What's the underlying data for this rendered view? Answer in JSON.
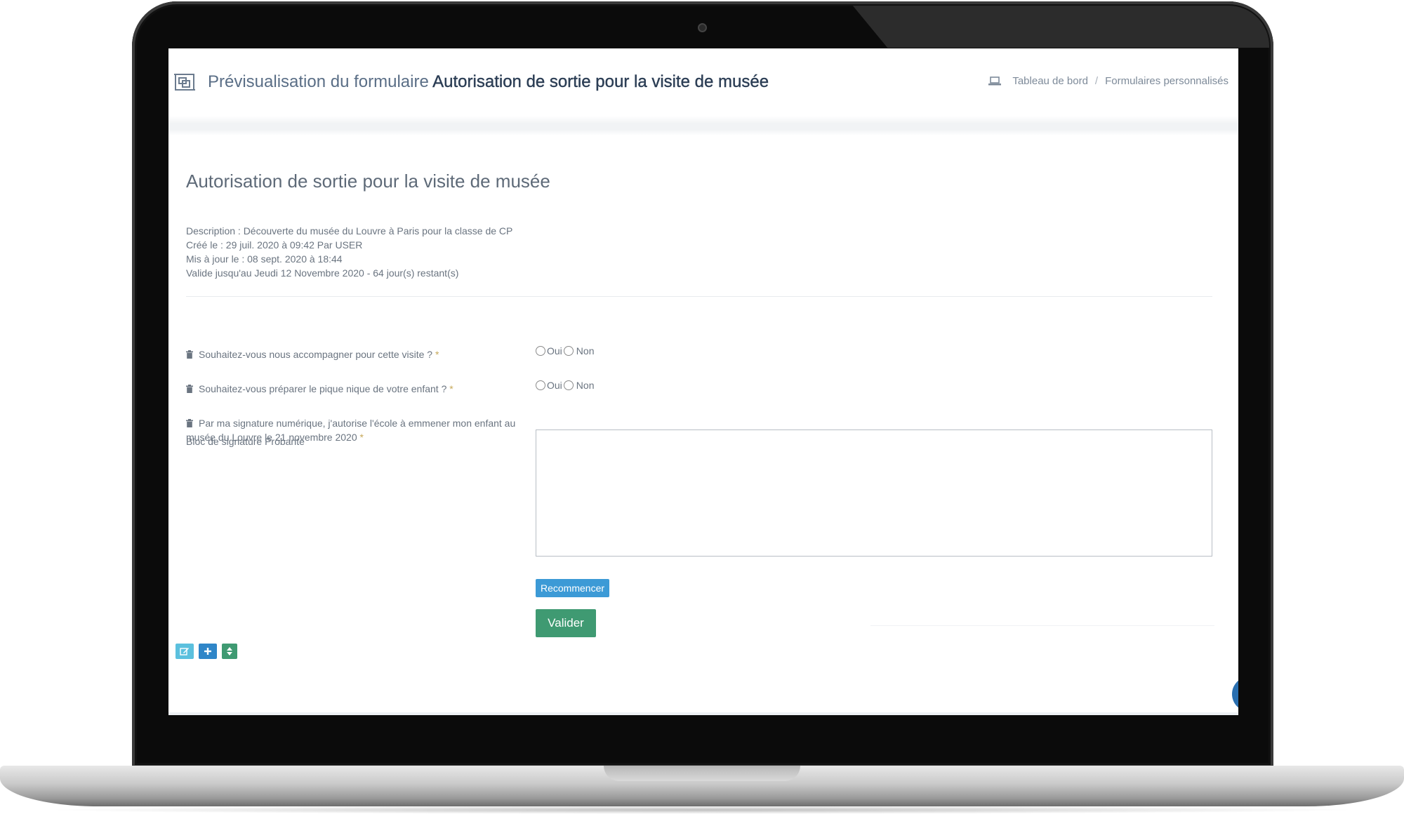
{
  "header": {
    "title_prefix": "Prévisualisation du formulaire",
    "title_form_name": "Autorisation de sortie pour la visite de musée",
    "breadcrumb": [
      "Tableau de bord",
      "Formulaires personnalisés"
    ],
    "breadcrumb_separator": "/"
  },
  "form": {
    "title": "Autorisation de sortie pour la visite de musée",
    "meta": [
      "Description : Découverte du musée du Louvre à Paris pour la classe de CP",
      "Créé le : 29 juil. 2020 à 09:42 Par USER",
      "Mis à jour le : 08 sept. 2020 à 18:44",
      "Valide jusqu'au Jeudi 12 Novembre 2020 - 64 jour(s) restant(s)"
    ],
    "questions": [
      {
        "label": "Souhaitez-vous nous accompagner pour cette visite ?",
        "required_mark": "*",
        "options": [
          "Oui",
          "Non"
        ]
      },
      {
        "label": "Souhaitez-vous préparer le pique nique de votre enfant ?",
        "required_mark": "*",
        "options": [
          "Oui",
          "Non"
        ]
      },
      {
        "label": "Par ma signature numérique, j'autorise l'école à emmener mon enfant au musée du Louvre le 21 novembre 2020",
        "required_mark": "*"
      }
    ],
    "signature_label": "Bloc de signature Probante",
    "restart_button": "Recommencer",
    "submit_button": "Valider"
  },
  "colors": {
    "primary_blue": "#3c9ad6",
    "submit_green": "#3f9a72",
    "edit_cyan": "#5bc0de",
    "add_blue": "#2f86c8",
    "required_gold": "#c7a95a"
  },
  "icons": {
    "header": "form-preview-icon",
    "breadcrumb": "laptop-icon",
    "question": "trash-icon",
    "toolbar": [
      "edit-icon",
      "plus-icon",
      "sort-icon"
    ]
  }
}
